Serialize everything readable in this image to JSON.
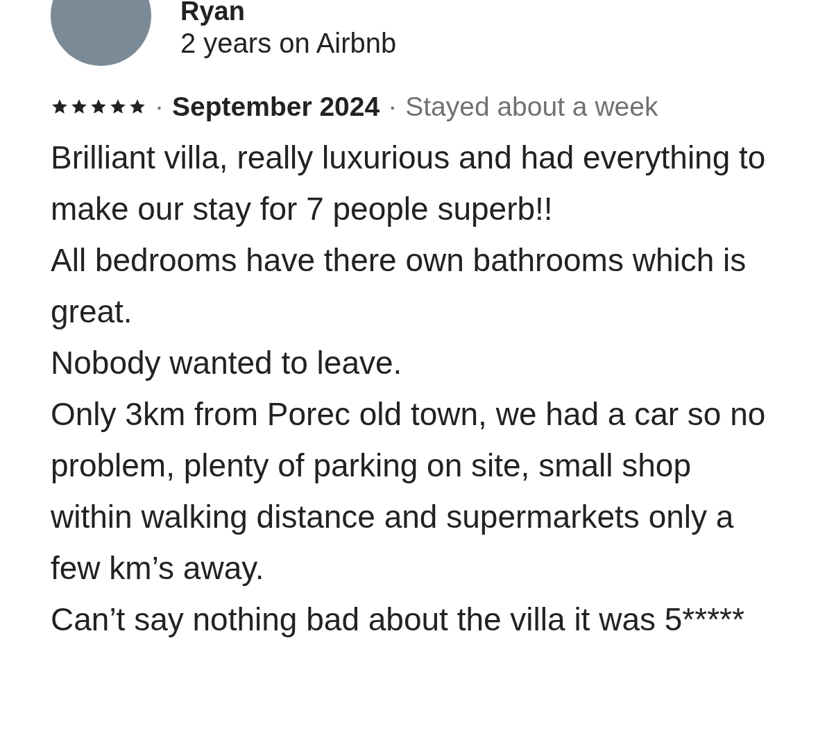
{
  "reviewer": {
    "name": "Ryan",
    "tenure": "2 years on Airbnb"
  },
  "meta": [
    {
      "kind": "stars",
      "stars": 5
    },
    {
      "kind": "separator",
      "text": "·"
    },
    {
      "kind": "date",
      "text": "September 2024"
    },
    {
      "kind": "separator",
      "text": "·"
    },
    {
      "kind": "stay",
      "text": "Stayed about a week"
    }
  ],
  "review_lines": [
    "Brilliant villa, really luxurious and had everything to make our stay for 7 people superb!!",
    "All bedrooms have there own bathrooms which is great.",
    "Nobody wanted to leave.",
    "Only 3km from Porec old town, we had a car so no problem, plenty of parking on site, small shop within walking distance and supermarkets only a few km’s away.",
    "Can’t say nothing bad about the villa it was 5*****"
  ]
}
